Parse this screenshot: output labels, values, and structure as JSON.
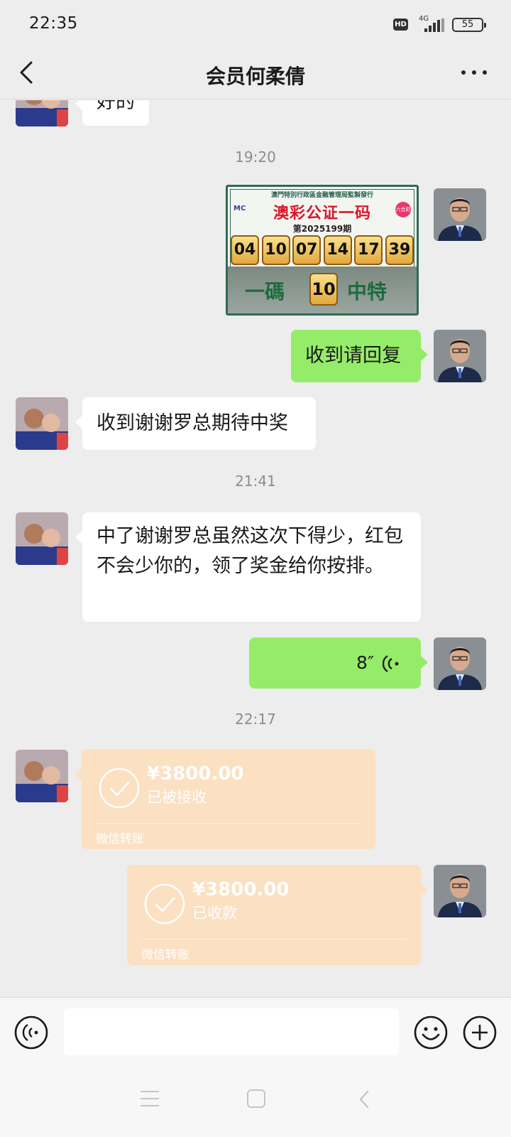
{
  "status_bar": {
    "time": "22:35",
    "hd": "HD",
    "network": "4G",
    "battery": "55"
  },
  "header": {
    "title": "会员何柔倩"
  },
  "messages": {
    "partial_text": "好的",
    "time1": "19:20",
    "lottery_image": {
      "top_text": "澳門特別行政區金融管理局監製發行",
      "title": "澳彩公证一码",
      "logo_left": "MC",
      "logo_right": "六合彩",
      "issue": "第2025199期",
      "numbers": [
        "04",
        "10",
        "07",
        "14",
        "17",
        "39"
      ],
      "bottom_left": "一碼",
      "special": "10",
      "bottom_right": "中特"
    },
    "out1": "收到请回复",
    "in1": "收到谢谢罗总期待中奖",
    "time2": "21:41",
    "in2": "中了谢谢罗总虽然这次下得少，红包不会少你的，领了奖金给你按排。",
    "voice_duration": "8″",
    "time3": "22:17",
    "transfer_in": {
      "amount": "¥3800.00",
      "status": "已被接收",
      "label": "微信转账"
    },
    "transfer_out": {
      "amount": "¥3800.00",
      "status": "已收款",
      "label": "微信转账"
    }
  },
  "input": {
    "value": ""
  },
  "colors": {
    "bg": "#ededed",
    "out_bubble": "#95ec69",
    "in_bubble": "#ffffff",
    "transfer": "#fbe0c2"
  },
  "icons": [
    "back-icon",
    "more-icon",
    "voice-icon",
    "emoji-icon",
    "plus-icon",
    "check-icon",
    "voice-wave-icon"
  ]
}
